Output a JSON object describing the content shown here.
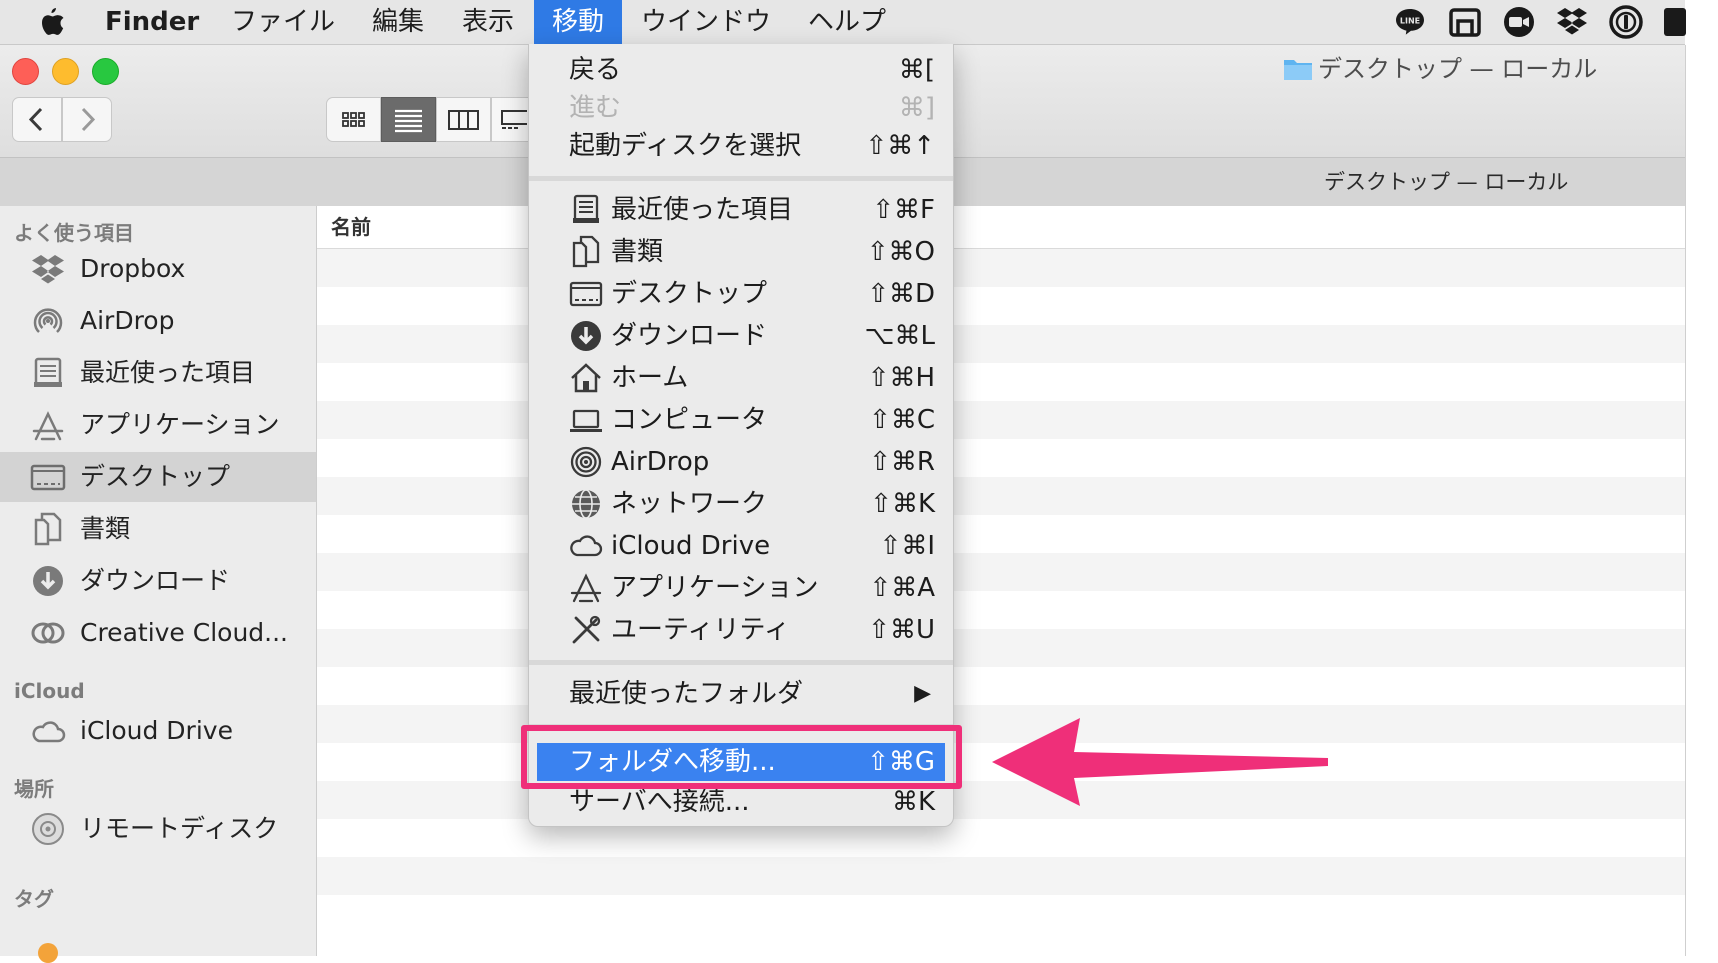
{
  "menubar": {
    "apple": "",
    "app": "Finder",
    "items": [
      "ファイル",
      "編集",
      "表示",
      "移動",
      "ウインドウ",
      "ヘルプ"
    ],
    "active_index": 3,
    "status_icons": [
      "line-icon",
      "screen-mirror-icon",
      "zoom-icon",
      "dropbox-icon",
      "1password-icon"
    ]
  },
  "window": {
    "title": "デスクトップ — ローカル",
    "path_title": "デスクトップ — ローカル",
    "nav": {
      "back": "‹",
      "forward": "›"
    },
    "view_modes": [
      "icon-view",
      "list-view",
      "column-view",
      "gallery-view"
    ],
    "selected_view": "list-view"
  },
  "sidebar": {
    "sections": [
      {
        "header": "よく使う項目",
        "items": [
          "Dropbox",
          "AirDrop",
          "最近使った項目",
          "アプリケーション",
          "デスクトップ",
          "書類",
          "ダウンロード",
          "Creative Cloud..."
        ]
      },
      {
        "header": "iCloud",
        "items": [
          "iCloud Drive"
        ]
      },
      {
        "header": "場所",
        "items": [
          "リモートディスク"
        ]
      },
      {
        "header": "タグ",
        "items": []
      }
    ],
    "selected": "デスクトップ"
  },
  "list": {
    "column_name": "名前"
  },
  "go_menu": {
    "items": [
      {
        "label": "戻る",
        "shortcut": "⌘["
      },
      {
        "label": "進む",
        "shortcut": "⌘]",
        "disabled": true
      },
      {
        "label": "起動ディスクを選択",
        "shortcut": "⇧⌘↑"
      },
      {
        "label": "最近使った項目",
        "shortcut": "⇧⌘F"
      },
      {
        "label": "書類",
        "shortcut": "⇧⌘O"
      },
      {
        "label": "デスクトップ",
        "shortcut": "⇧⌘D"
      },
      {
        "label": "ダウンロード",
        "shortcut": "⌥⌘L"
      },
      {
        "label": "ホーム",
        "shortcut": "⇧⌘H"
      },
      {
        "label": "コンピュータ",
        "shortcut": "⇧⌘C"
      },
      {
        "label": "AirDrop",
        "shortcut": "⇧⌘R"
      },
      {
        "label": "ネットワーク",
        "shortcut": "⇧⌘K"
      },
      {
        "label": "iCloud Drive",
        "shortcut": "⇧⌘I"
      },
      {
        "label": "アプリケーション",
        "shortcut": "⇧⌘A"
      },
      {
        "label": "ユーティリティ",
        "shortcut": "⇧⌘U"
      },
      {
        "label": "最近使ったフォルダ",
        "shortcut": "▶"
      },
      {
        "label": "フォルダへ移動...",
        "shortcut": "⇧⌘G",
        "highlighted": true
      },
      {
        "label": "サーバへ接続...",
        "shortcut": "⌘K"
      }
    ]
  },
  "annotation": {
    "color": "#ef2f79",
    "points_to": "フォルダへ移動..."
  },
  "colors": {
    "accent": "#3a82f0",
    "annotation": "#ef2f79"
  }
}
